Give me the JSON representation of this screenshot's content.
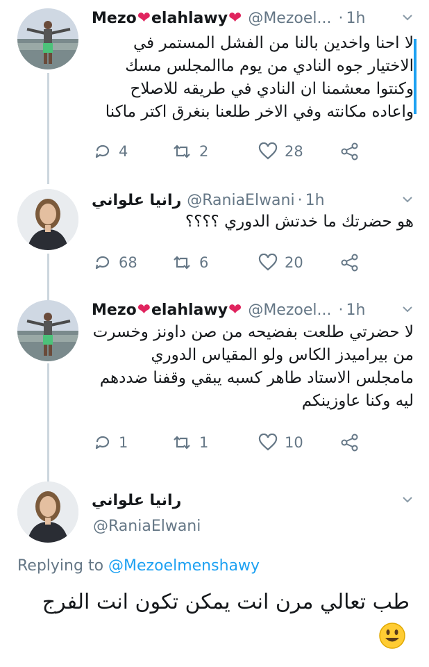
{
  "tweets": [
    {
      "name_left": "Mezo",
      "name_right": "elahlawy",
      "handle": "@Mezoel...",
      "time": "1h",
      "text": "لا احنا واخدين بالنا من الفشل المستمر في الاختيار جوه النادي من يوم ماالمجلس مسك وكنتوا معشمنا ان النادي في طريقه للاصلاح واعاده مكانته وفي الاخر طلعنا بنغرق اكتر ماكنا",
      "replies": "4",
      "retweets": "2",
      "likes": "28"
    },
    {
      "name": "رانيا علواني",
      "handle": "@RaniaElwani",
      "time": "1h",
      "text": "هو حضرتك ما خدتش الدوري ؟؟؟؟",
      "replies": "68",
      "retweets": "6",
      "likes": "20"
    },
    {
      "name_left": "Mezo",
      "name_right": "elahlawy",
      "handle": "@Mezoel...",
      "time": "1h",
      "text": "لا حضرتي طلعت بفضيحه من صن داونز وخسرت من بيراميدز الكاس ولو المقياس الدوري مامجلس الاستاد طاهر كسبه يبقي وقفنا ضددهم ليه وكنا عاوزينكم",
      "replies": "1",
      "retweets": "1",
      "likes": "10"
    }
  ],
  "main_tweet": {
    "name": "رانيا علواني",
    "handle": "@RaniaElwani",
    "replying_prefix": "Replying to",
    "replying_to": "@Mezoelmenshawy",
    "text": "طب تعالي مرن انت يمكن تكون انت الفرج"
  },
  "colors": {
    "accent": "#1da1f2",
    "muted": "#657786",
    "heart": "#e0245e",
    "thread": "#ccd6dd"
  },
  "icons": [
    "reply-icon",
    "retweet-icon",
    "like-icon",
    "share-icon",
    "caret-down-icon",
    "heart-emoji-icon",
    "smiley-emoji-icon"
  ]
}
